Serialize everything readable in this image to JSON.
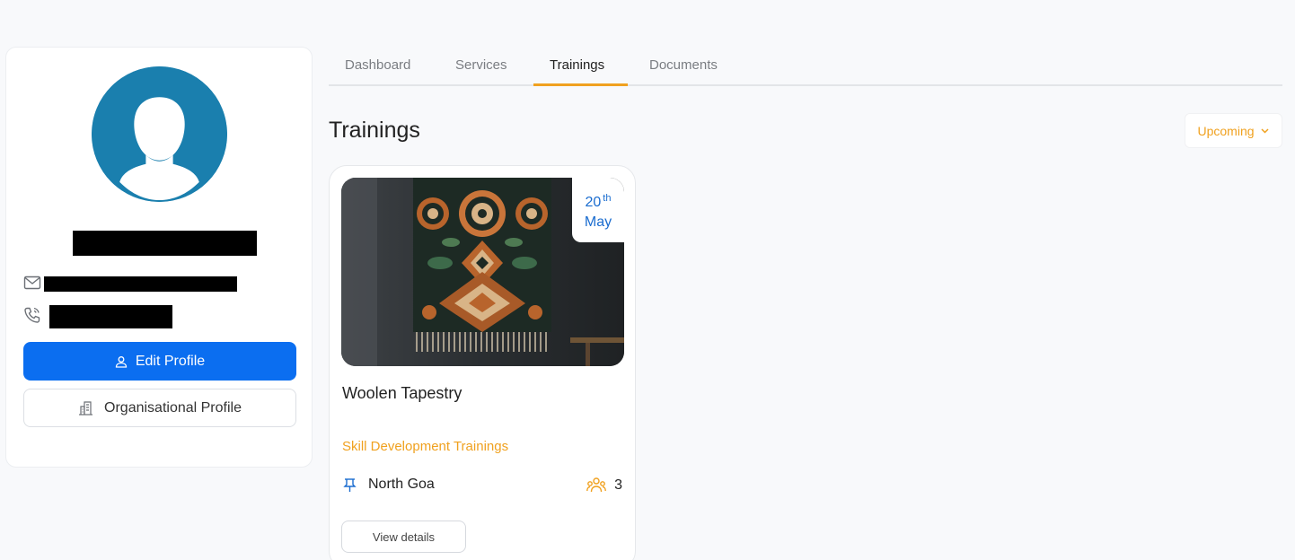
{
  "profile": {
    "edit_profile_label": "Edit Profile",
    "organisational_profile_label": "Organisational Profile",
    "avatar_color": "#1a7fae"
  },
  "tabs": [
    {
      "label": "Dashboard",
      "active": false
    },
    {
      "label": "Services",
      "active": false
    },
    {
      "label": "Trainings",
      "active": true
    },
    {
      "label": "Documents",
      "active": false
    }
  ],
  "section": {
    "title": "Trainings",
    "filter_label": "Upcoming"
  },
  "training": {
    "date_day": "20",
    "date_suffix": "th",
    "date_month": "May",
    "title": "Woolen Tapestry",
    "category": "Skill Development Trainings",
    "location": "North Goa",
    "participants": "3",
    "details_label": "View details"
  },
  "colors": {
    "primary": "#0b6ef0",
    "accent": "#f0a11f",
    "date_blue": "#1a6ccf"
  }
}
